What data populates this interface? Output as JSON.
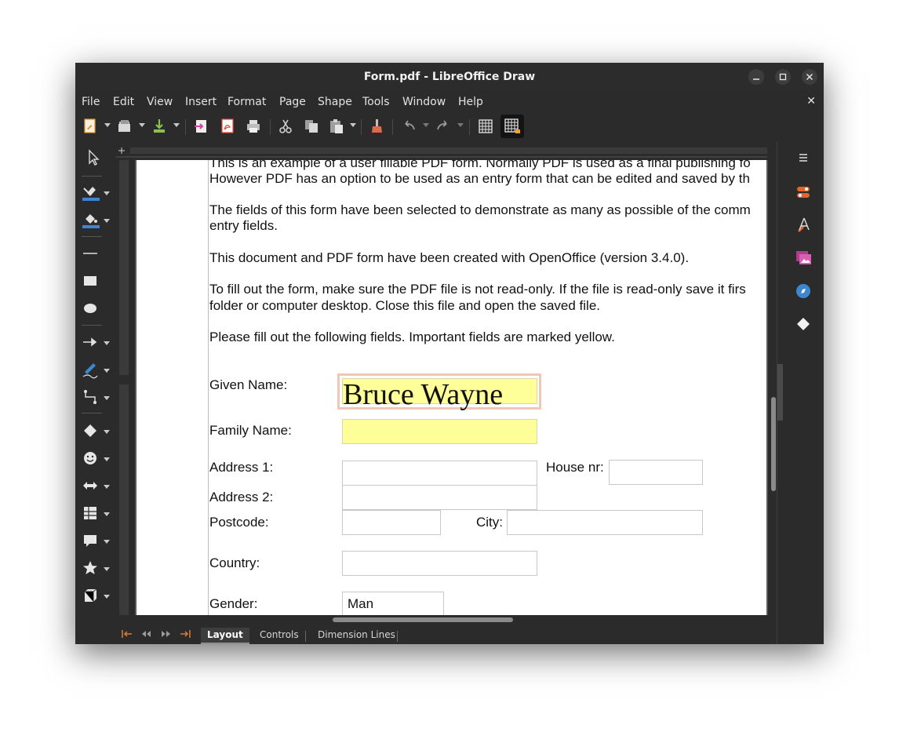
{
  "window": {
    "title": "Form.pdf - LibreOffice Draw"
  },
  "menubar": {
    "items": [
      "File",
      "Edit",
      "View",
      "Insert",
      "Format",
      "Page",
      "Shape",
      "Tools",
      "Window",
      "Help"
    ],
    "close_glyph": "✕"
  },
  "document": {
    "paragraphs": [
      "This is an example of a user fillable PDF form. Normally PDF is used as a final publishing fo",
      "However PDF has an option to be used as an entry form that can be edited and saved by th",
      "The fields of this form have been selected to demonstrate as many as possible of the comm",
      "entry fields.",
      "This document and PDF form have been created with OpenOffice (version 3.4.0).",
      "To fill out the form, make sure the PDF file is not read-only. If the file is read-only save it firs",
      "folder or computer desktop. Close this file and open the saved file.",
      "Please fill out the following fields. Important fields are marked yellow."
    ],
    "form": {
      "given_name_label": "Given Name:",
      "given_name_value": "Bruce Wayne",
      "family_name_label": "Family Name:",
      "family_name_value": "",
      "address1_label": "Address 1:",
      "address2_label": "Address 2:",
      "house_nr_label": "House nr:",
      "postcode_label": "Postcode:",
      "city_label": "City:",
      "country_label": "Country:",
      "gender_label": "Gender:",
      "gender_value": "Man"
    }
  },
  "tabs": {
    "items": [
      "Layout",
      "Controls",
      "Dimension Lines"
    ],
    "active": "Layout"
  },
  "colors": {
    "required_field": "#ffff99",
    "selection_border": "#f0c6b4",
    "nav_accent": "#d97d3a"
  }
}
